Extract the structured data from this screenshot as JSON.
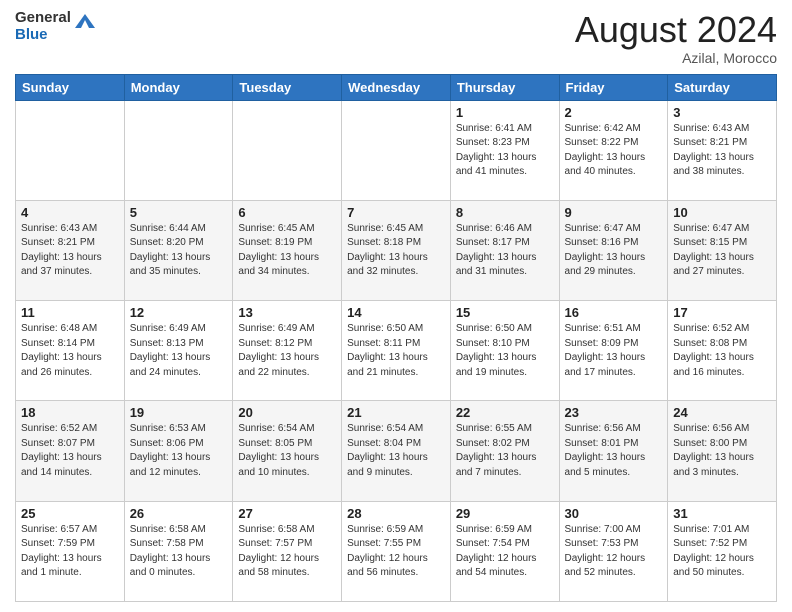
{
  "logo": {
    "line1": "General",
    "line2": "Blue"
  },
  "header": {
    "month_year": "August 2024",
    "location": "Azilal, Morocco"
  },
  "weekdays": [
    "Sunday",
    "Monday",
    "Tuesday",
    "Wednesday",
    "Thursday",
    "Friday",
    "Saturday"
  ],
  "weeks": [
    [
      {
        "day": "",
        "info": ""
      },
      {
        "day": "",
        "info": ""
      },
      {
        "day": "",
        "info": ""
      },
      {
        "day": "",
        "info": ""
      },
      {
        "day": "1",
        "info": "Sunrise: 6:41 AM\nSunset: 8:23 PM\nDaylight: 13 hours\nand 41 minutes."
      },
      {
        "day": "2",
        "info": "Sunrise: 6:42 AM\nSunset: 8:22 PM\nDaylight: 13 hours\nand 40 minutes."
      },
      {
        "day": "3",
        "info": "Sunrise: 6:43 AM\nSunset: 8:21 PM\nDaylight: 13 hours\nand 38 minutes."
      }
    ],
    [
      {
        "day": "4",
        "info": "Sunrise: 6:43 AM\nSunset: 8:21 PM\nDaylight: 13 hours\nand 37 minutes."
      },
      {
        "day": "5",
        "info": "Sunrise: 6:44 AM\nSunset: 8:20 PM\nDaylight: 13 hours\nand 35 minutes."
      },
      {
        "day": "6",
        "info": "Sunrise: 6:45 AM\nSunset: 8:19 PM\nDaylight: 13 hours\nand 34 minutes."
      },
      {
        "day": "7",
        "info": "Sunrise: 6:45 AM\nSunset: 8:18 PM\nDaylight: 13 hours\nand 32 minutes."
      },
      {
        "day": "8",
        "info": "Sunrise: 6:46 AM\nSunset: 8:17 PM\nDaylight: 13 hours\nand 31 minutes."
      },
      {
        "day": "9",
        "info": "Sunrise: 6:47 AM\nSunset: 8:16 PM\nDaylight: 13 hours\nand 29 minutes."
      },
      {
        "day": "10",
        "info": "Sunrise: 6:47 AM\nSunset: 8:15 PM\nDaylight: 13 hours\nand 27 minutes."
      }
    ],
    [
      {
        "day": "11",
        "info": "Sunrise: 6:48 AM\nSunset: 8:14 PM\nDaylight: 13 hours\nand 26 minutes."
      },
      {
        "day": "12",
        "info": "Sunrise: 6:49 AM\nSunset: 8:13 PM\nDaylight: 13 hours\nand 24 minutes."
      },
      {
        "day": "13",
        "info": "Sunrise: 6:49 AM\nSunset: 8:12 PM\nDaylight: 13 hours\nand 22 minutes."
      },
      {
        "day": "14",
        "info": "Sunrise: 6:50 AM\nSunset: 8:11 PM\nDaylight: 13 hours\nand 21 minutes."
      },
      {
        "day": "15",
        "info": "Sunrise: 6:50 AM\nSunset: 8:10 PM\nDaylight: 13 hours\nand 19 minutes."
      },
      {
        "day": "16",
        "info": "Sunrise: 6:51 AM\nSunset: 8:09 PM\nDaylight: 13 hours\nand 17 minutes."
      },
      {
        "day": "17",
        "info": "Sunrise: 6:52 AM\nSunset: 8:08 PM\nDaylight: 13 hours\nand 16 minutes."
      }
    ],
    [
      {
        "day": "18",
        "info": "Sunrise: 6:52 AM\nSunset: 8:07 PM\nDaylight: 13 hours\nand 14 minutes."
      },
      {
        "day": "19",
        "info": "Sunrise: 6:53 AM\nSunset: 8:06 PM\nDaylight: 13 hours\nand 12 minutes."
      },
      {
        "day": "20",
        "info": "Sunrise: 6:54 AM\nSunset: 8:05 PM\nDaylight: 13 hours\nand 10 minutes."
      },
      {
        "day": "21",
        "info": "Sunrise: 6:54 AM\nSunset: 8:04 PM\nDaylight: 13 hours\nand 9 minutes."
      },
      {
        "day": "22",
        "info": "Sunrise: 6:55 AM\nSunset: 8:02 PM\nDaylight: 13 hours\nand 7 minutes."
      },
      {
        "day": "23",
        "info": "Sunrise: 6:56 AM\nSunset: 8:01 PM\nDaylight: 13 hours\nand 5 minutes."
      },
      {
        "day": "24",
        "info": "Sunrise: 6:56 AM\nSunset: 8:00 PM\nDaylight: 13 hours\nand 3 minutes."
      }
    ],
    [
      {
        "day": "25",
        "info": "Sunrise: 6:57 AM\nSunset: 7:59 PM\nDaylight: 13 hours\nand 1 minute."
      },
      {
        "day": "26",
        "info": "Sunrise: 6:58 AM\nSunset: 7:58 PM\nDaylight: 13 hours\nand 0 minutes."
      },
      {
        "day": "27",
        "info": "Sunrise: 6:58 AM\nSunset: 7:57 PM\nDaylight: 12 hours\nand 58 minutes."
      },
      {
        "day": "28",
        "info": "Sunrise: 6:59 AM\nSunset: 7:55 PM\nDaylight: 12 hours\nand 56 minutes."
      },
      {
        "day": "29",
        "info": "Sunrise: 6:59 AM\nSunset: 7:54 PM\nDaylight: 12 hours\nand 54 minutes."
      },
      {
        "day": "30",
        "info": "Sunrise: 7:00 AM\nSunset: 7:53 PM\nDaylight: 12 hours\nand 52 minutes."
      },
      {
        "day": "31",
        "info": "Sunrise: 7:01 AM\nSunset: 7:52 PM\nDaylight: 12 hours\nand 50 minutes."
      }
    ]
  ]
}
